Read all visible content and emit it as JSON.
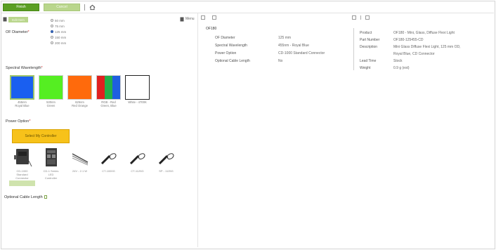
{
  "toolbar": {
    "primary_label": "Finish",
    "secondary_label": "Cancel"
  },
  "left_panel": {
    "tab_label": "Edit Item",
    "right_text": "Menu"
  },
  "fiber_diameter": {
    "label": "OF Diameter",
    "required_mark": "*",
    "options": [
      "50 mm",
      "75 mm",
      "125 mm",
      "150 mm",
      "200 mm"
    ],
    "selected_index": 2
  },
  "spectral_wavelength": {
    "label": "Spectral Wavelength",
    "required_mark": "*",
    "swatches": [
      {
        "label_line1": "455nm",
        "label_line2": "Royal Blue",
        "color": "#1a5ff0"
      },
      {
        "label_line1": "530nm",
        "label_line2": "Green",
        "color": "#55ee22"
      },
      {
        "label_line1": "625nm",
        "label_line2": "Red Orange",
        "color": "#ff6a0c"
      },
      {
        "label_line1": "RGB - Red",
        "label_line2": "Green, Blue",
        "colors": [
          "#e02020",
          "#22b04a",
          "#1e5fe0"
        ]
      },
      {
        "label_line1": "White - 4700K",
        "label_line2": "",
        "color": "#ffffff"
      }
    ],
    "selected_index": 0
  },
  "power_option": {
    "label": "Power Option",
    "required_mark": "*",
    "button_label": "Select My Controller",
    "options": [
      {
        "label_line1": "CD-1000",
        "label_line2": "Standard",
        "label_line3": "Connector"
      },
      {
        "label_line1": "CD-1 Series",
        "label_line2": "LED",
        "label_line3": "Controller"
      },
      {
        "label_line1": "24V - 2.1 W",
        "label_line2": "",
        "label_line3": ""
      },
      {
        "label_line1": "CT-1000G",
        "label_line2": "",
        "label_line3": ""
      },
      {
        "label_line1": "CT-1125G",
        "label_line2": "",
        "label_line3": ""
      },
      {
        "label_line1": "SP - 1125G",
        "label_line2": "",
        "label_line3": ""
      }
    ],
    "selected_index": 0
  },
  "cable_length": {
    "label": "Optional Cable Length"
  },
  "summary": {
    "title": "OF180",
    "rows": [
      {
        "key": "OF Diameter",
        "value": "125 mm"
      },
      {
        "key": "Spectral Wavelength",
        "value": "455nm - Royal Blue"
      },
      {
        "key": "Power Option",
        "value": "CD-1000 Standard Connector"
      },
      {
        "key": "Optional Cable Length",
        "value": "No"
      }
    ]
  },
  "product_info": {
    "rows": [
      {
        "key": "Product",
        "value": "OF180 - Mini, Glass, Diffuse Flexi Light"
      },
      {
        "key": "Part Number",
        "value": "OF180-125455-CD"
      },
      {
        "key": "Description",
        "value": "Mini Glass Diffuse Flexi Light, 125 mm OD,"
      },
      {
        "key": "",
        "value": "Royal Blue, CD Connector"
      },
      {
        "key": "Lead Time",
        "value": "Stock"
      },
      {
        "key": "Weight",
        "value": "0.9 g (est)"
      }
    ]
  }
}
